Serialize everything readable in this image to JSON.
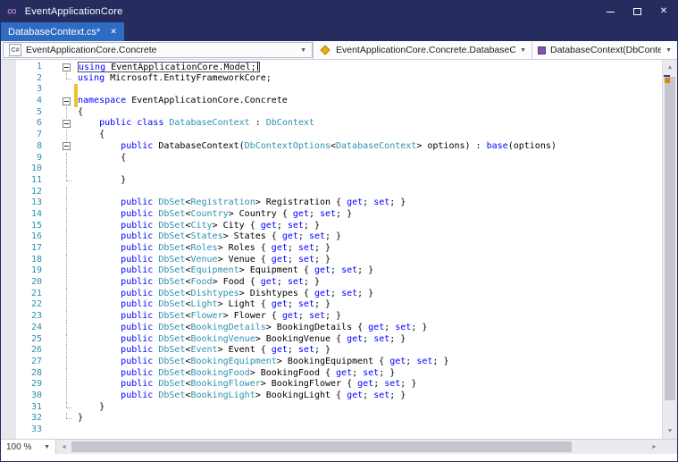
{
  "theme": {
    "title-bar-bg": "#272c5f",
    "window-border": "#272c5f",
    "tab-active-bg": "#2e6bc2",
    "tab-text": "#ffffff",
    "navbar-bg": "#fcfcfd",
    "navbar-border": "#cccedb",
    "editor-bg": "#ffffff",
    "glyph-margin-bg": "#e8e8ec",
    "line-number": "#2b91af",
    "kw": "#0000ff",
    "type": "#2b91af",
    "plain": "#000000",
    "change-unsaved": "#edc32a",
    "scroll-track": "#ebebef",
    "scroll-thumb": "#c5c6cc",
    "scroll-arrow": "#8a8e9e",
    "fold-line": "#a8a8a8",
    "caret-line-border": "#4b4b6b",
    "marker-orange": "#cf8a12",
    "marker-caret": "#3b3b8f"
  },
  "icons": {
    "vs_logo": "∞",
    "close": "✕",
    "chevron_down": "▼",
    "scroll_up": "▲",
    "scroll_down": "▼",
    "scroll_left": "◄",
    "scroll_right": "►",
    "csharp_file": "C#"
  },
  "titlebar": {
    "title": "EventApplicationCore"
  },
  "tab": {
    "label": "DatabaseContext.cs*"
  },
  "navbar": {
    "project": "EventApplicationCore.Concrete",
    "class": "EventApplicationCore.Concrete.DatabaseContext",
    "member": "DatabaseContext(DbContextOptions<DatabaseConte"
  },
  "bottombar": {
    "zoom": "100 %"
  },
  "editor": {
    "lines": [
      {
        "n": 1,
        "outline": "box",
        "caret": true,
        "tokens": [
          [
            "k",
            "using"
          ],
          [
            "p",
            " EventApplicationCore.Model;"
          ]
        ]
      },
      {
        "n": 2,
        "outline": "end",
        "tokens": [
          [
            "k",
            "using"
          ],
          [
            "p",
            " Microsoft.EntityFrameworkCore;"
          ]
        ]
      },
      {
        "n": 3,
        "outline": "",
        "changed": true,
        "tokens": []
      },
      {
        "n": 4,
        "outline": "box",
        "changed": true,
        "tokens": [
          [
            "k",
            "namespace"
          ],
          [
            "p",
            " EventApplicationCore.Concrete"
          ]
        ]
      },
      {
        "n": 5,
        "outline": "line",
        "tokens": [
          [
            "p",
            "{"
          ]
        ]
      },
      {
        "n": 6,
        "outline": "box",
        "tokens": [
          [
            "p",
            "    "
          ],
          [
            "k",
            "public"
          ],
          [
            "p",
            " "
          ],
          [
            "k",
            "class"
          ],
          [
            "p",
            " "
          ],
          [
            "t",
            "DatabaseContext"
          ],
          [
            "p",
            " : "
          ],
          [
            "t",
            "DbContext"
          ]
        ]
      },
      {
        "n": 7,
        "outline": "line",
        "tokens": [
          [
            "p",
            "    {"
          ]
        ]
      },
      {
        "n": 8,
        "outline": "box",
        "tokens": [
          [
            "p",
            "        "
          ],
          [
            "k",
            "public"
          ],
          [
            "p",
            " DatabaseContext("
          ],
          [
            "t",
            "DbContextOptions"
          ],
          [
            "p",
            "<"
          ],
          [
            "t",
            "DatabaseContext"
          ],
          [
            "p",
            "> options) : "
          ],
          [
            "k",
            "base"
          ],
          [
            "p",
            "(options)"
          ]
        ]
      },
      {
        "n": 9,
        "outline": "line",
        "tokens": [
          [
            "p",
            "        {"
          ]
        ]
      },
      {
        "n": 10,
        "outline": "line",
        "tokens": []
      },
      {
        "n": 11,
        "outline": "end",
        "tokens": [
          [
            "p",
            "        }"
          ]
        ]
      },
      {
        "n": 12,
        "outline": "line",
        "tokens": []
      },
      {
        "n": 13,
        "outline": "line",
        "tokens": [
          [
            "p",
            "        "
          ],
          [
            "k",
            "public"
          ],
          [
            "p",
            " "
          ],
          [
            "t",
            "DbSet"
          ],
          [
            "p",
            "<"
          ],
          [
            "t",
            "Registration"
          ],
          [
            "p",
            "> Registration { "
          ],
          [
            "k",
            "get"
          ],
          [
            "p",
            "; "
          ],
          [
            "k",
            "set"
          ],
          [
            "p",
            "; }"
          ]
        ]
      },
      {
        "n": 14,
        "outline": "line",
        "tokens": [
          [
            "p",
            "        "
          ],
          [
            "k",
            "public"
          ],
          [
            "p",
            " "
          ],
          [
            "t",
            "DbSet"
          ],
          [
            "p",
            "<"
          ],
          [
            "t",
            "Country"
          ],
          [
            "p",
            "> Country { "
          ],
          [
            "k",
            "get"
          ],
          [
            "p",
            "; "
          ],
          [
            "k",
            "set"
          ],
          [
            "p",
            "; }"
          ]
        ]
      },
      {
        "n": 15,
        "outline": "line",
        "tokens": [
          [
            "p",
            "        "
          ],
          [
            "k",
            "public"
          ],
          [
            "p",
            " "
          ],
          [
            "t",
            "DbSet"
          ],
          [
            "p",
            "<"
          ],
          [
            "t",
            "City"
          ],
          [
            "p",
            "> City { "
          ],
          [
            "k",
            "get"
          ],
          [
            "p",
            "; "
          ],
          [
            "k",
            "set"
          ],
          [
            "p",
            "; }"
          ]
        ]
      },
      {
        "n": 16,
        "outline": "line",
        "tokens": [
          [
            "p",
            "        "
          ],
          [
            "k",
            "public"
          ],
          [
            "p",
            " "
          ],
          [
            "t",
            "DbSet"
          ],
          [
            "p",
            "<"
          ],
          [
            "t",
            "States"
          ],
          [
            "p",
            "> States { "
          ],
          [
            "k",
            "get"
          ],
          [
            "p",
            "; "
          ],
          [
            "k",
            "set"
          ],
          [
            "p",
            "; }"
          ]
        ]
      },
      {
        "n": 17,
        "outline": "line",
        "tokens": [
          [
            "p",
            "        "
          ],
          [
            "k",
            "public"
          ],
          [
            "p",
            " "
          ],
          [
            "t",
            "DbSet"
          ],
          [
            "p",
            "<"
          ],
          [
            "t",
            "Roles"
          ],
          [
            "p",
            "> Roles { "
          ],
          [
            "k",
            "get"
          ],
          [
            "p",
            "; "
          ],
          [
            "k",
            "set"
          ],
          [
            "p",
            "; }"
          ]
        ]
      },
      {
        "n": 18,
        "outline": "line",
        "tokens": [
          [
            "p",
            "        "
          ],
          [
            "k",
            "public"
          ],
          [
            "p",
            " "
          ],
          [
            "t",
            "DbSet"
          ],
          [
            "p",
            "<"
          ],
          [
            "t",
            "Venue"
          ],
          [
            "p",
            "> Venue { "
          ],
          [
            "k",
            "get"
          ],
          [
            "p",
            "; "
          ],
          [
            "k",
            "set"
          ],
          [
            "p",
            "; }"
          ]
        ]
      },
      {
        "n": 19,
        "outline": "line",
        "tokens": [
          [
            "p",
            "        "
          ],
          [
            "k",
            "public"
          ],
          [
            "p",
            " "
          ],
          [
            "t",
            "DbSet"
          ],
          [
            "p",
            "<"
          ],
          [
            "t",
            "Equipment"
          ],
          [
            "p",
            "> Equipment { "
          ],
          [
            "k",
            "get"
          ],
          [
            "p",
            "; "
          ],
          [
            "k",
            "set"
          ],
          [
            "p",
            "; }"
          ]
        ]
      },
      {
        "n": 20,
        "outline": "line",
        "tokens": [
          [
            "p",
            "        "
          ],
          [
            "k",
            "public"
          ],
          [
            "p",
            " "
          ],
          [
            "t",
            "DbSet"
          ],
          [
            "p",
            "<"
          ],
          [
            "t",
            "Food"
          ],
          [
            "p",
            "> Food { "
          ],
          [
            "k",
            "get"
          ],
          [
            "p",
            "; "
          ],
          [
            "k",
            "set"
          ],
          [
            "p",
            "; }"
          ]
        ]
      },
      {
        "n": 21,
        "outline": "line",
        "tokens": [
          [
            "p",
            "        "
          ],
          [
            "k",
            "public"
          ],
          [
            "p",
            " "
          ],
          [
            "t",
            "DbSet"
          ],
          [
            "p",
            "<"
          ],
          [
            "t",
            "Dishtypes"
          ],
          [
            "p",
            "> Dishtypes { "
          ],
          [
            "k",
            "get"
          ],
          [
            "p",
            "; "
          ],
          [
            "k",
            "set"
          ],
          [
            "p",
            "; }"
          ]
        ]
      },
      {
        "n": 22,
        "outline": "line",
        "tokens": [
          [
            "p",
            "        "
          ],
          [
            "k",
            "public"
          ],
          [
            "p",
            " "
          ],
          [
            "t",
            "DbSet"
          ],
          [
            "p",
            "<"
          ],
          [
            "t",
            "Light"
          ],
          [
            "p",
            "> Light { "
          ],
          [
            "k",
            "get"
          ],
          [
            "p",
            "; "
          ],
          [
            "k",
            "set"
          ],
          [
            "p",
            "; }"
          ]
        ]
      },
      {
        "n": 23,
        "outline": "line",
        "tokens": [
          [
            "p",
            "        "
          ],
          [
            "k",
            "public"
          ],
          [
            "p",
            " "
          ],
          [
            "t",
            "DbSet"
          ],
          [
            "p",
            "<"
          ],
          [
            "t",
            "Flower"
          ],
          [
            "p",
            "> Flower { "
          ],
          [
            "k",
            "get"
          ],
          [
            "p",
            "; "
          ],
          [
            "k",
            "set"
          ],
          [
            "p",
            "; }"
          ]
        ]
      },
      {
        "n": 24,
        "outline": "line",
        "tokens": [
          [
            "p",
            "        "
          ],
          [
            "k",
            "public"
          ],
          [
            "p",
            " "
          ],
          [
            "t",
            "DbSet"
          ],
          [
            "p",
            "<"
          ],
          [
            "t",
            "BookingDetails"
          ],
          [
            "p",
            "> BookingDetails { "
          ],
          [
            "k",
            "get"
          ],
          [
            "p",
            "; "
          ],
          [
            "k",
            "set"
          ],
          [
            "p",
            "; }"
          ]
        ]
      },
      {
        "n": 25,
        "outline": "line",
        "tokens": [
          [
            "p",
            "        "
          ],
          [
            "k",
            "public"
          ],
          [
            "p",
            " "
          ],
          [
            "t",
            "DbSet"
          ],
          [
            "p",
            "<"
          ],
          [
            "t",
            "BookingVenue"
          ],
          [
            "p",
            "> BookingVenue { "
          ],
          [
            "k",
            "get"
          ],
          [
            "p",
            "; "
          ],
          [
            "k",
            "set"
          ],
          [
            "p",
            "; }"
          ]
        ]
      },
      {
        "n": 26,
        "outline": "line",
        "tokens": [
          [
            "p",
            "        "
          ],
          [
            "k",
            "public"
          ],
          [
            "p",
            " "
          ],
          [
            "t",
            "DbSet"
          ],
          [
            "p",
            "<"
          ],
          [
            "t",
            "Event"
          ],
          [
            "p",
            "> Event { "
          ],
          [
            "k",
            "get"
          ],
          [
            "p",
            "; "
          ],
          [
            "k",
            "set"
          ],
          [
            "p",
            "; }"
          ]
        ]
      },
      {
        "n": 27,
        "outline": "line",
        "tokens": [
          [
            "p",
            "        "
          ],
          [
            "k",
            "public"
          ],
          [
            "p",
            " "
          ],
          [
            "t",
            "DbSet"
          ],
          [
            "p",
            "<"
          ],
          [
            "t",
            "BookingEquipment"
          ],
          [
            "p",
            "> BookingEquipment { "
          ],
          [
            "k",
            "get"
          ],
          [
            "p",
            "; "
          ],
          [
            "k",
            "set"
          ],
          [
            "p",
            "; }"
          ]
        ]
      },
      {
        "n": 28,
        "outline": "line",
        "tokens": [
          [
            "p",
            "        "
          ],
          [
            "k",
            "public"
          ],
          [
            "p",
            " "
          ],
          [
            "t",
            "DbSet"
          ],
          [
            "p",
            "<"
          ],
          [
            "t",
            "BookingFood"
          ],
          [
            "p",
            "> BookingFood { "
          ],
          [
            "k",
            "get"
          ],
          [
            "p",
            "; "
          ],
          [
            "k",
            "set"
          ],
          [
            "p",
            "; }"
          ]
        ]
      },
      {
        "n": 29,
        "outline": "line",
        "tokens": [
          [
            "p",
            "        "
          ],
          [
            "k",
            "public"
          ],
          [
            "p",
            " "
          ],
          [
            "t",
            "DbSet"
          ],
          [
            "p",
            "<"
          ],
          [
            "t",
            "BookingFlower"
          ],
          [
            "p",
            "> BookingFlower { "
          ],
          [
            "k",
            "get"
          ],
          [
            "p",
            "; "
          ],
          [
            "k",
            "set"
          ],
          [
            "p",
            "; }"
          ]
        ]
      },
      {
        "n": 30,
        "outline": "line",
        "tokens": [
          [
            "p",
            "        "
          ],
          [
            "k",
            "public"
          ],
          [
            "p",
            " "
          ],
          [
            "t",
            "DbSet"
          ],
          [
            "p",
            "<"
          ],
          [
            "t",
            "BookingLight"
          ],
          [
            "p",
            "> BookingLight { "
          ],
          [
            "k",
            "get"
          ],
          [
            "p",
            "; "
          ],
          [
            "k",
            "set"
          ],
          [
            "p",
            "; }"
          ]
        ]
      },
      {
        "n": 31,
        "outline": "end",
        "tokens": [
          [
            "p",
            "    }"
          ]
        ]
      },
      {
        "n": 32,
        "outline": "end",
        "tokens": [
          [
            "p",
            "}"
          ]
        ]
      },
      {
        "n": 33,
        "outline": "",
        "tokens": []
      }
    ]
  }
}
